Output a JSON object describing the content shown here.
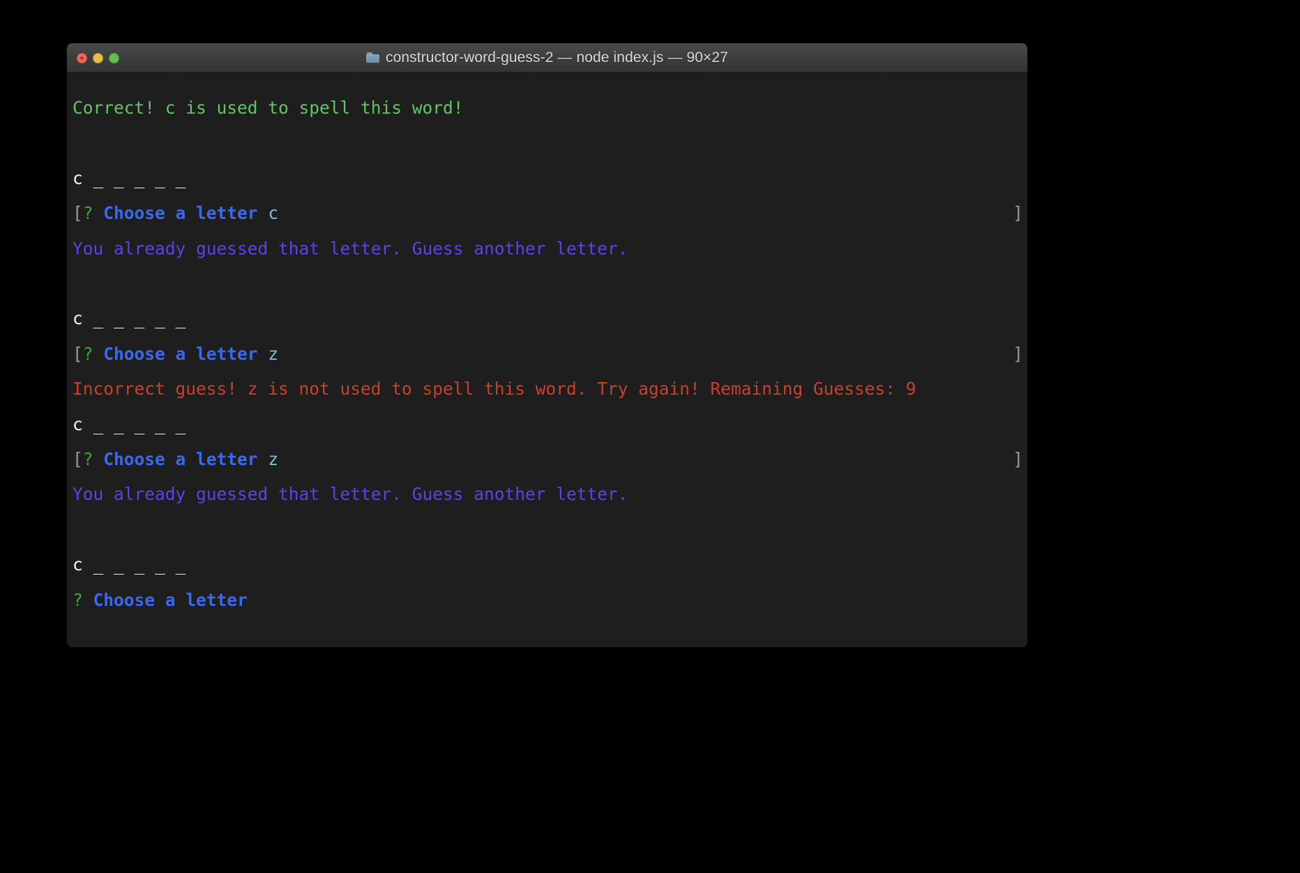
{
  "window": {
    "title": "constructor-word-guess-2 — node index.js — 90×27",
    "folder_icon": "folder-icon",
    "controls": {
      "close": "close-button",
      "minimize": "minimize-button",
      "maximize": "maximize-button"
    }
  },
  "colors": {
    "success": "#5fc75f",
    "warning": "#5b43e8",
    "error": "#c9402b",
    "prompt": "#3b68f0",
    "answer": "#72c3c9",
    "word": "#f2f2f2",
    "bracket": "#9a9a9a",
    "question": "#3fa63f",
    "terminal_bg": "#1e1e1e",
    "titlebar_bg": "#3c3c3c"
  },
  "terminal": {
    "messages": {
      "correct": "Correct! c is used to spell this word!",
      "already_guessed": "You already guessed that letter. Guess another letter.",
      "incorrect": "Incorrect guess! z is not used to spell this word. Try again! Remaining Guesses: 9"
    },
    "word_display": "c _ _ _ _ _",
    "prompt_label": "Choose a letter",
    "prompt_question_mark": "?",
    "bracket_open": "[",
    "bracket_close": "]",
    "answers": {
      "first": "c",
      "second": "z",
      "third": "z"
    }
  }
}
